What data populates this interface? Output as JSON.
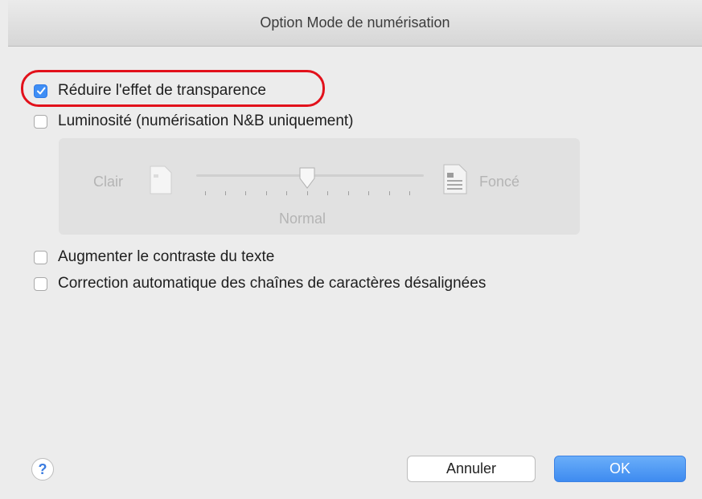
{
  "dialog": {
    "title": "Option Mode de numérisation"
  },
  "options": {
    "reduce_transparency": {
      "label": "Réduire l'effet de transparence",
      "checked": true
    },
    "brightness": {
      "label": "Luminosité (numérisation N&B uniquement)",
      "checked": false
    },
    "contrast": {
      "label": "Augmenter le contraste du texte",
      "checked": false
    },
    "auto_correction": {
      "label": "Correction automatique des chaînes de caractères désalignées",
      "checked": false
    }
  },
  "brightness_slider": {
    "min_label": "Clair",
    "max_label": "Foncé",
    "value_label": "Normal",
    "value": 0.5,
    "enabled": false
  },
  "buttons": {
    "help": "?",
    "cancel": "Annuler",
    "ok": "OK"
  },
  "colors": {
    "accent": "#3f8ef5",
    "highlight": "#e2111b"
  }
}
